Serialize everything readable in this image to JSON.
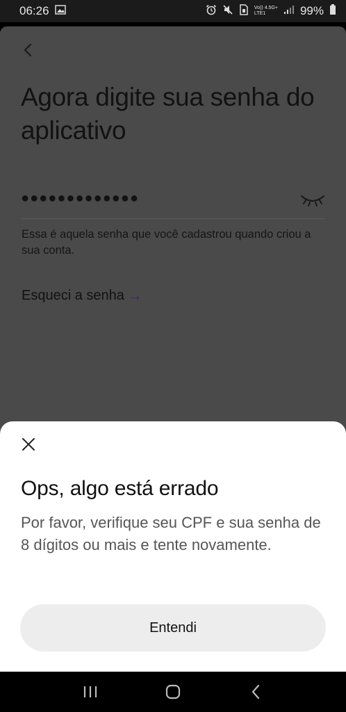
{
  "status_bar": {
    "time": "06:26",
    "network_label_top": "Vo)) 4.5G+",
    "network_label_bottom": "LTE1",
    "battery": "99%"
  },
  "screen": {
    "title": "Agora digite sua senha do aplicativo",
    "password_masked": "●●●●●●●●●●●●●",
    "hint": "Essa é aquela senha que você cadastrou quando criou a sua conta.",
    "forgot_label": "Esqueci a senha",
    "forgot_arrow": "→"
  },
  "sheet": {
    "title": "Ops, algo está errado",
    "message": "Por favor, verifique seu CPF e sua senha de 8 dígitos ou mais e tente novamente.",
    "button_label": "Entendi"
  },
  "colors": {
    "overlay_bg": "#4a4a4a",
    "accent_arrow": "#4a1d6e",
    "button_bg": "#ededed"
  },
  "icons": [
    "gallery-icon",
    "alarm-icon",
    "mute-icon",
    "sim-icon",
    "signal-icon",
    "battery-icon",
    "back-arrow-icon",
    "eye-closed-icon",
    "close-icon",
    "recent-apps-icon",
    "home-icon",
    "nav-back-icon"
  ]
}
